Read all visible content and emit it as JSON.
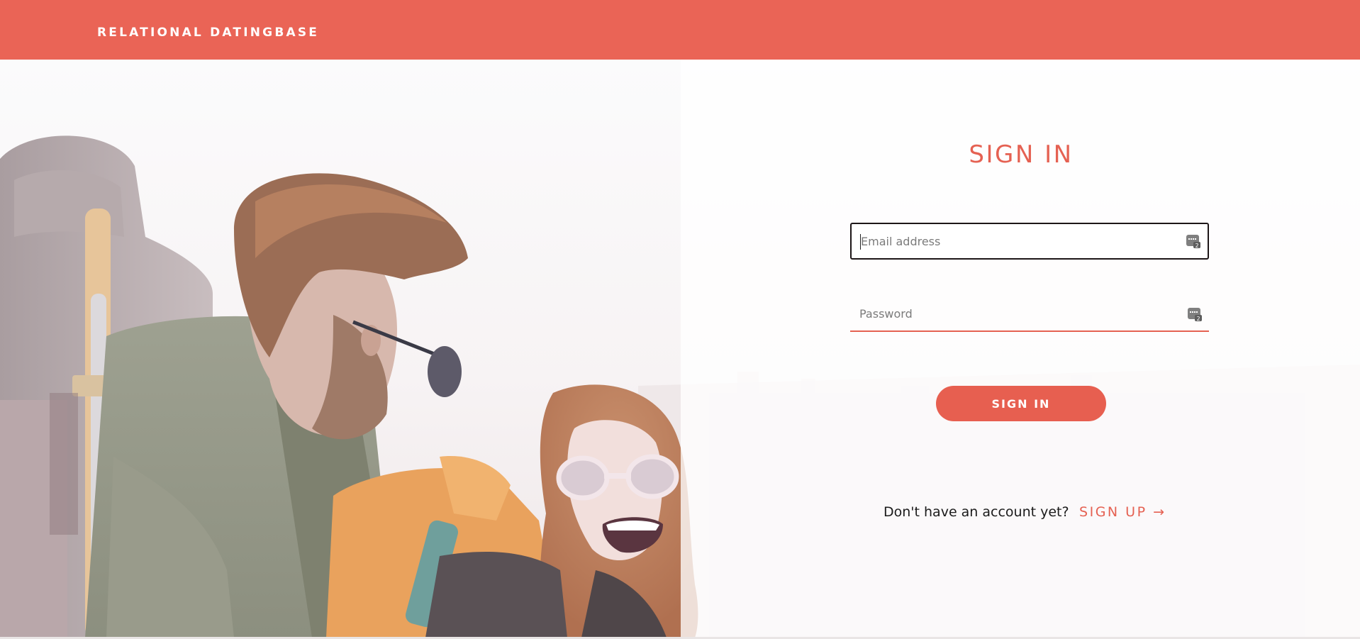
{
  "header": {
    "brand": "RELATIONAL DATINGBASE"
  },
  "signin": {
    "title": "SIGN IN",
    "email_placeholder": "Email address",
    "password_placeholder": "Password",
    "button_label": "SIGN IN"
  },
  "signup": {
    "question": "Don't have an account yet?",
    "link_label": "SIGN UP →"
  },
  "colors": {
    "accent": "#ea6456",
    "accent_text": "#e56152",
    "focus_border": "#1d1617"
  },
  "icons": {
    "header_logo": "none",
    "field_icon": "password-manager-icon",
    "hero": "couple-photo"
  }
}
